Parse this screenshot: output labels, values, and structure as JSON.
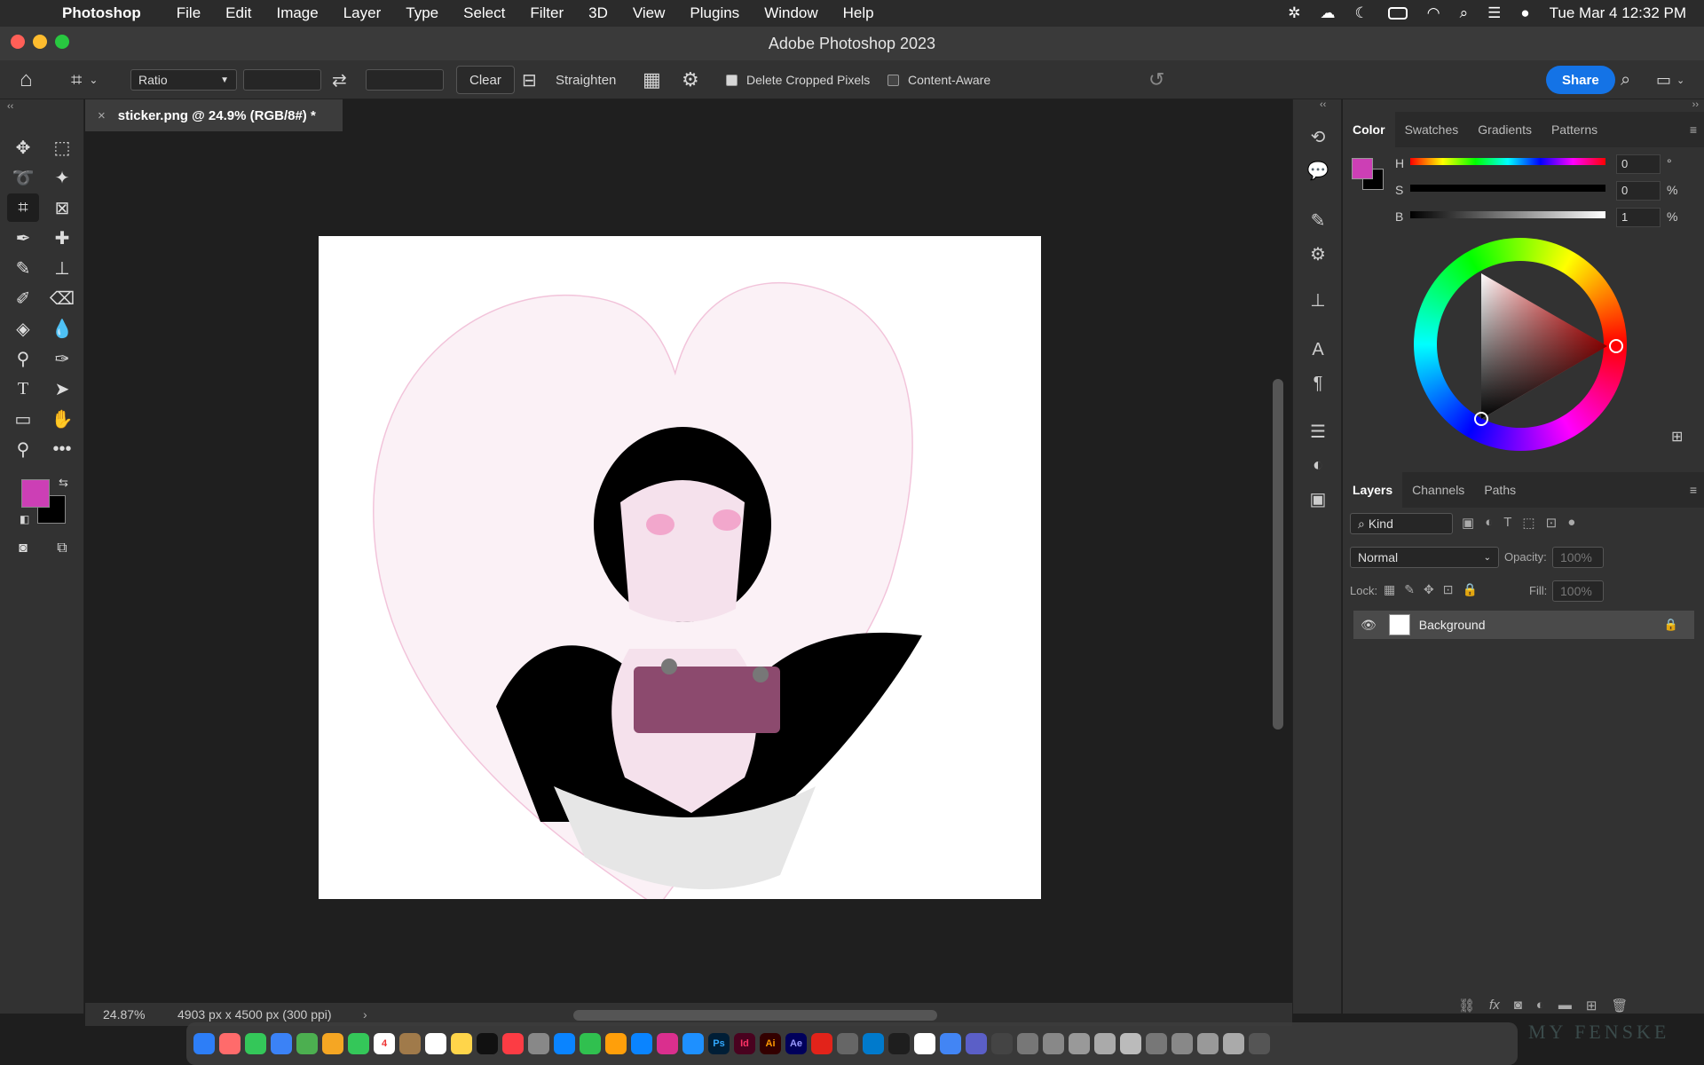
{
  "menubar": {
    "app_name": "Photoshop",
    "items": [
      "File",
      "Edit",
      "Image",
      "Layer",
      "Type",
      "Select",
      "Filter",
      "3D",
      "View",
      "Plugins",
      "Window",
      "Help"
    ],
    "clock": "Tue Mar 4  12:32 PM"
  },
  "window": {
    "title": "Adobe Photoshop 2023"
  },
  "options_bar": {
    "ratio_label": "Ratio",
    "width_value": "",
    "height_value": "",
    "clear_label": "Clear",
    "straighten_label": "Straighten",
    "delete_cropped_label": "Delete Cropped Pixels",
    "delete_cropped_checked": true,
    "content_aware_label": "Content-Aware",
    "content_aware_checked": false,
    "share_label": "Share"
  },
  "document": {
    "tab_title": "sticker.png @ 24.9% (RGB/8#) *",
    "zoom": "24.87%",
    "dimensions": "4903 px x 4500 px (300 ppi)"
  },
  "color_panel": {
    "tabs": [
      "Color",
      "Swatches",
      "Gradients",
      "Patterns"
    ],
    "active_tab": "Color",
    "foreground": "#cc3fb5",
    "background": "#000000",
    "h": {
      "label": "H",
      "value": "0",
      "unit": "°"
    },
    "s": {
      "label": "S",
      "value": "0",
      "unit": "%"
    },
    "b": {
      "label": "B",
      "value": "1",
      "unit": "%"
    }
  },
  "layers_panel": {
    "tabs": [
      "Layers",
      "Channels",
      "Paths"
    ],
    "active_tab": "Layers",
    "filter_kind": "Kind",
    "blend_mode": "Normal",
    "opacity_label": "Opacity:",
    "opacity_value": "100%",
    "lock_label": "Lock:",
    "fill_label": "Fill:",
    "fill_value": "100%",
    "layers": [
      {
        "name": "Background",
        "visible": true,
        "locked": true
      }
    ]
  },
  "dock": {
    "apps": [
      "Ps",
      "Id",
      "Ai",
      "Ae"
    ],
    "watermark": "MY FENSKE"
  }
}
